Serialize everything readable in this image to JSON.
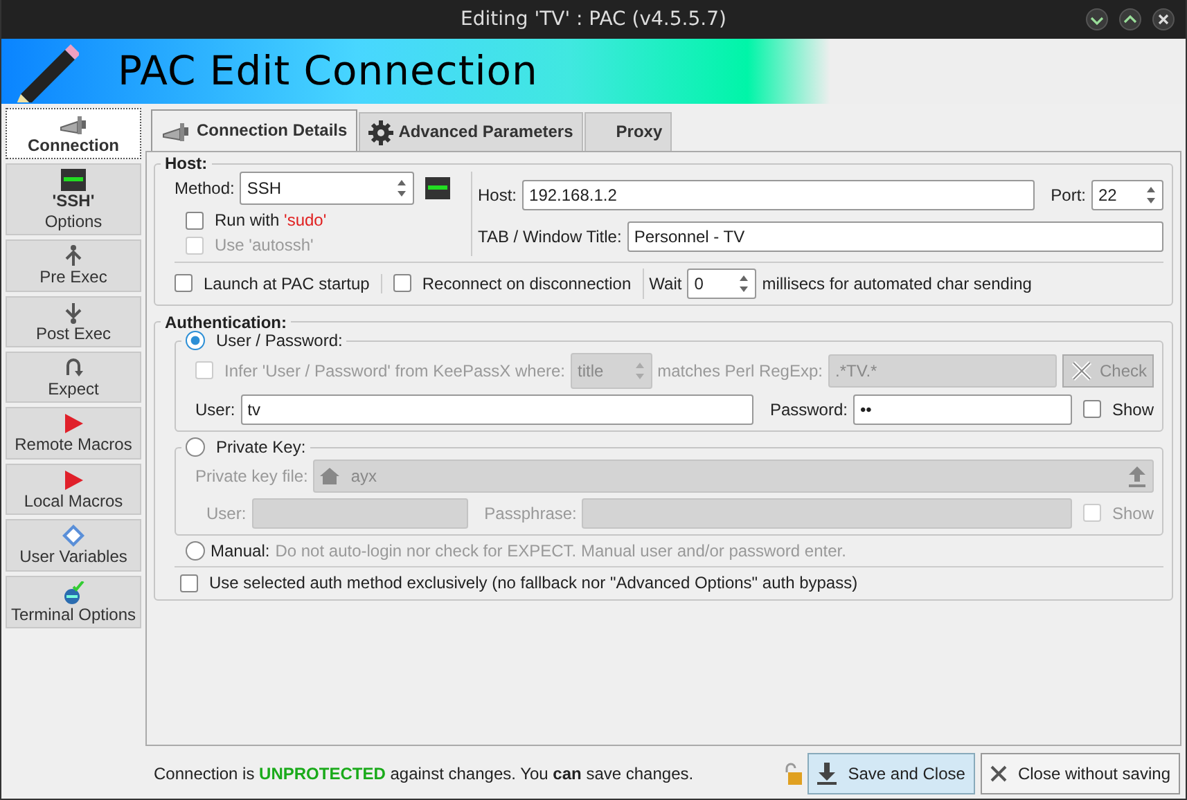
{
  "window": {
    "title": "Editing 'TV' : PAC (v4.5.5.7)"
  },
  "banner": {
    "title": "PAC Edit Connection"
  },
  "sidebar": {
    "items": [
      {
        "label": "Connection",
        "kind": "connection",
        "selected": true
      },
      {
        "title": "'SSH'",
        "label": "Options",
        "kind": "ssh",
        "selected": false
      },
      {
        "label": "Pre Exec",
        "kind": "pre",
        "selected": false
      },
      {
        "label": "Post Exec",
        "kind": "post",
        "selected": false
      },
      {
        "label": "Expect",
        "kind": "expect",
        "selected": false
      },
      {
        "label": "Remote Macros",
        "kind": "macro",
        "selected": false
      },
      {
        "label": "Local Macros",
        "kind": "macro",
        "selected": false
      },
      {
        "label": "User Variables",
        "kind": "variables",
        "selected": false
      },
      {
        "label": "Terminal Options",
        "kind": "terminal",
        "selected": false
      }
    ]
  },
  "tabs": [
    {
      "label": "Connection Details",
      "kind": "connection",
      "selected": true
    },
    {
      "label": "Advanced Parameters",
      "kind": "gear",
      "selected": false
    },
    {
      "label": "Proxy",
      "kind": "blank",
      "selected": false
    }
  ],
  "host": {
    "legend": "Host:",
    "method": {
      "label": "Method:",
      "value": "SSH"
    },
    "sudo": {
      "label": "Run with",
      "accent": "'sudo'",
      "checked": false,
      "disabled": false
    },
    "autossh": {
      "label": "Use 'autossh'",
      "checked": false,
      "disabled": true
    },
    "host": {
      "label": "Host:",
      "value": "192.168.1.2"
    },
    "port": {
      "label": "Port:",
      "value": "22"
    },
    "tab_title": {
      "label": "TAB / Window Title:",
      "value": "Personnel - TV"
    },
    "launch": {
      "label": "Launch at PAC startup",
      "checked": false
    },
    "reconnect": {
      "label": "Reconnect on disconnection",
      "checked": false
    },
    "wait": {
      "label": "Wait",
      "value": "0",
      "suffix": "millisecs for automated char sending"
    }
  },
  "auth": {
    "legend": "Authentication:",
    "user_password": {
      "label": "User / Password:",
      "selected": true,
      "infer": {
        "label": "Infer 'User / Password' from KeePassX where:",
        "checked": false,
        "disabled": true
      },
      "where": {
        "value": "title",
        "disabled": true
      },
      "regexp": {
        "label": "matches Perl RegExp:",
        "value": ".*TV.*",
        "disabled": true
      },
      "check": {
        "label": "Check",
        "disabled": true
      },
      "user": {
        "label": "User:",
        "value": "tv"
      },
      "password": {
        "label": "Password:",
        "value": "••"
      },
      "show": {
        "label": "Show",
        "checked": false,
        "disabled": false
      }
    },
    "private_key": {
      "label": "Private Key:",
      "selected": false,
      "file": {
        "label": "Private key file:",
        "value": "ayx",
        "disabled": true
      },
      "user": {
        "label": "User:",
        "disabled": true
      },
      "passphrase": {
        "label": "Passphrase:",
        "disabled": true
      },
      "show": {
        "label": "Show",
        "checked": false,
        "disabled": true
      }
    },
    "manual": {
      "label": "Manual:",
      "text": "Do not auto-login nor check for EXPECT. Manual user and/or password enter.",
      "selected": false
    },
    "exclusive": {
      "label": "Use selected auth method exclusively (no fallback nor \"Advanced Options\" auth bypass)",
      "checked": false
    }
  },
  "footer": {
    "status": "Connection is **UNPROTECTED** against changes. You **can** save changes.",
    "save": "Save and Close",
    "close": "Close without saving"
  }
}
